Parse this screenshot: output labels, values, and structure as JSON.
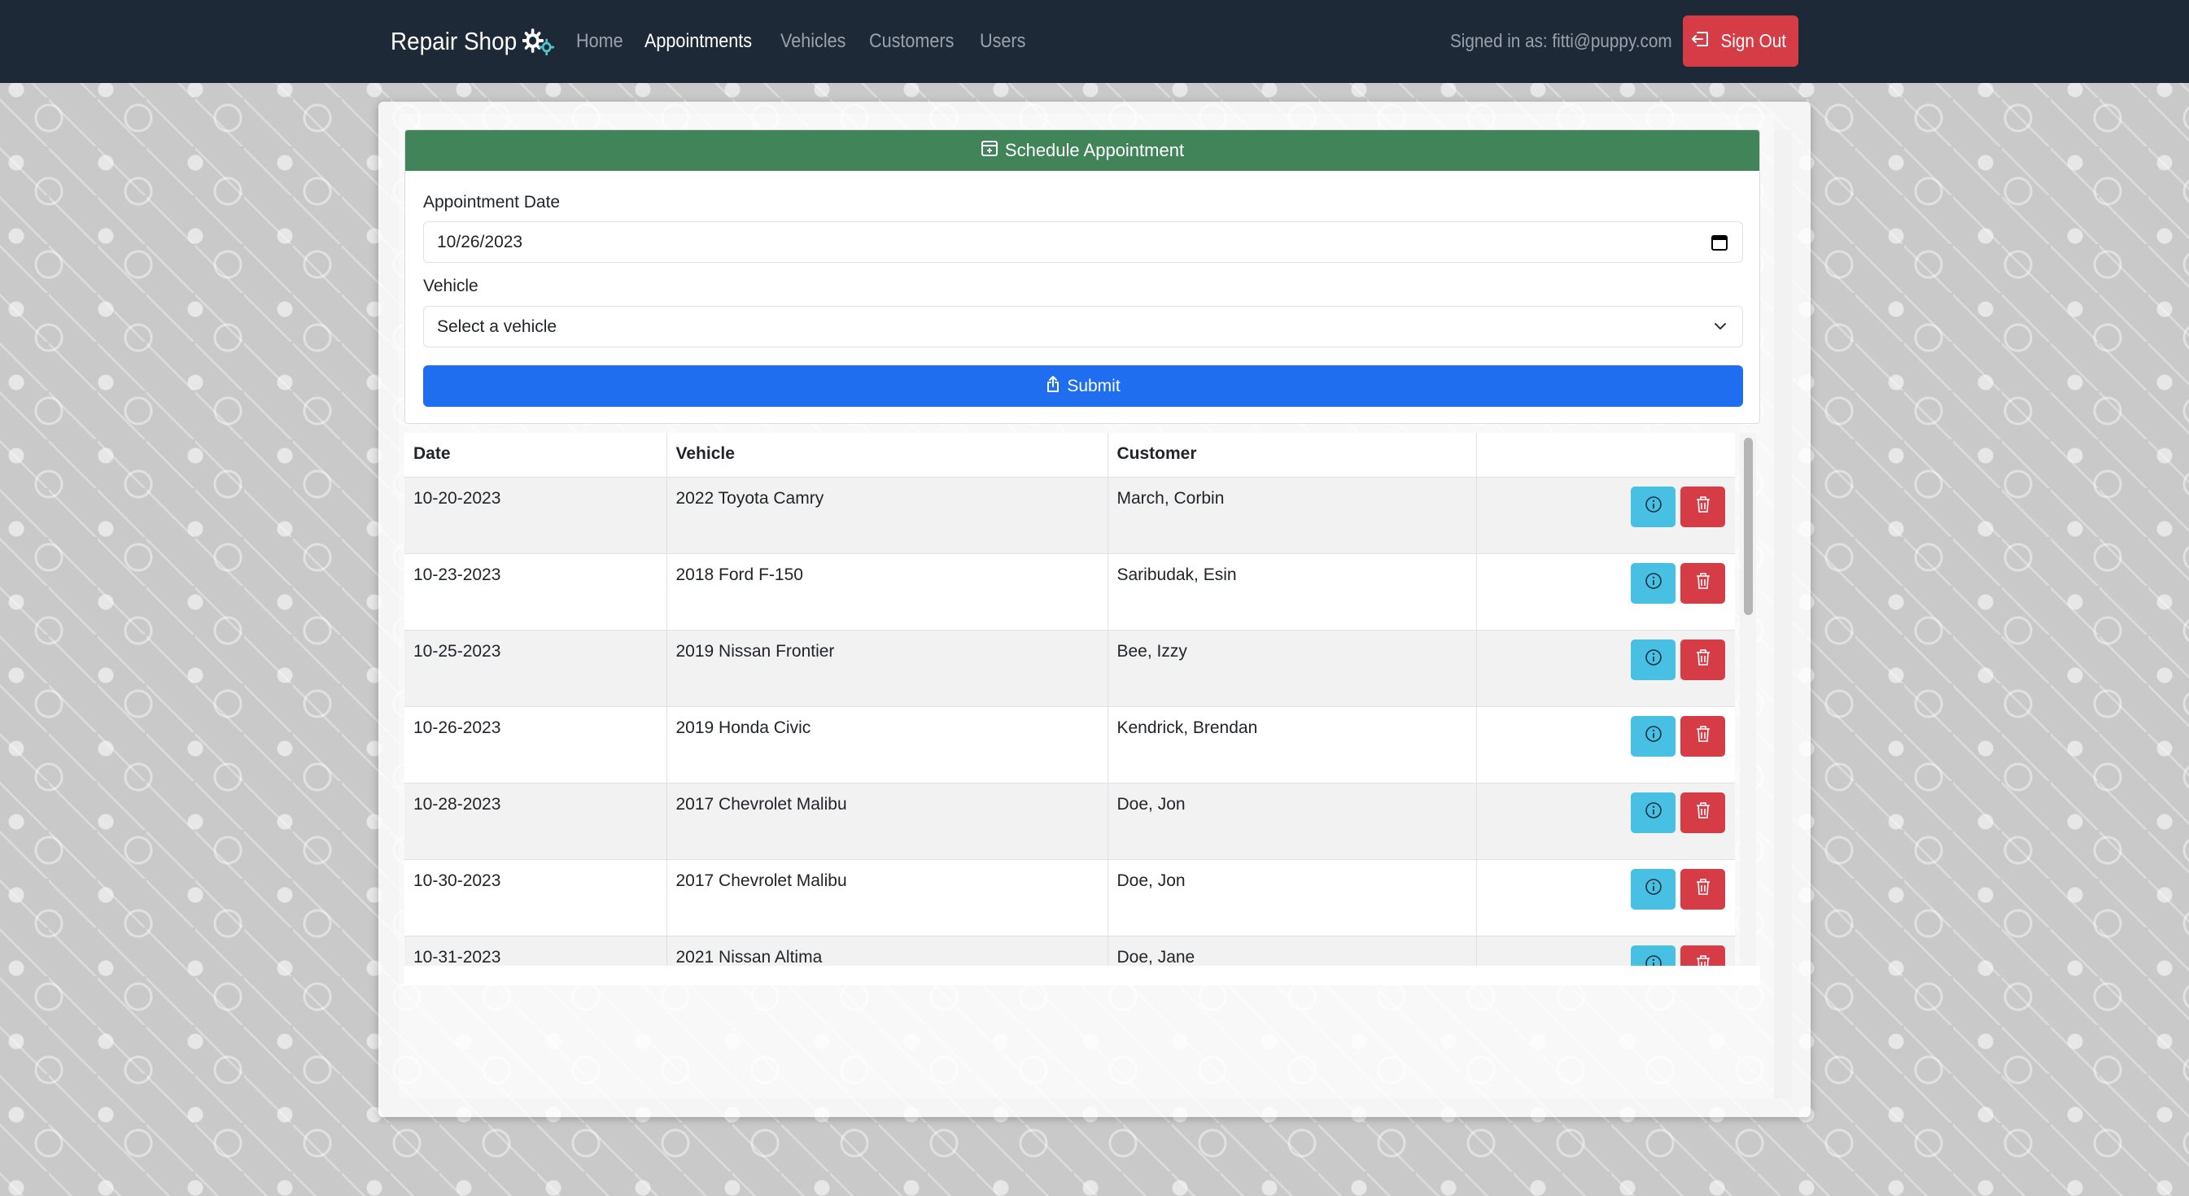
{
  "navbar": {
    "brand": "Repair Shop",
    "brand_icon": "gears-icon",
    "links": [
      {
        "label": "Home",
        "active": false
      },
      {
        "label": "Appointments",
        "active": true
      },
      {
        "label": "Vehicles",
        "active": false
      },
      {
        "label": "Customers",
        "active": false
      },
      {
        "label": "Users",
        "active": false
      }
    ],
    "signed_in_text": "Signed in as: fitti@puppy.com",
    "sign_out_label": "Sign Out"
  },
  "form": {
    "header": "Schedule Appointment",
    "date_label": "Appointment Date",
    "date_value": "10/26/2023",
    "vehicle_label": "Vehicle",
    "vehicle_selected": "Select a vehicle",
    "submit_label": "Submit"
  },
  "table": {
    "headers": [
      "Date",
      "Vehicle",
      "Customer",
      ""
    ],
    "rows": [
      {
        "date": "10-20-2023",
        "vehicle": "2022 Toyota Camry",
        "customer": "March, Corbin"
      },
      {
        "date": "10-23-2023",
        "vehicle": "2018 Ford F-150",
        "customer": "Saribudak, Esin"
      },
      {
        "date": "10-25-2023",
        "vehicle": "2019 Nissan Frontier",
        "customer": "Bee, Izzy"
      },
      {
        "date": "10-26-2023",
        "vehicle": "2019 Honda Civic",
        "customer": "Kendrick, Brendan"
      },
      {
        "date": "10-28-2023",
        "vehicle": "2017 Chevrolet Malibu",
        "customer": "Doe, Jon"
      },
      {
        "date": "10-30-2023",
        "vehicle": "2017 Chevrolet Malibu",
        "customer": "Doe, Jon"
      },
      {
        "date": "10-31-2023",
        "vehicle": "2021 Nissan Altima",
        "customer": "Doe, Jane"
      }
    ]
  },
  "colors": {
    "navbar": "#1e2938",
    "form_header": "#41845a",
    "submit": "#1f6ef0",
    "info": "#47c0e3",
    "danger": "#d63c46"
  }
}
